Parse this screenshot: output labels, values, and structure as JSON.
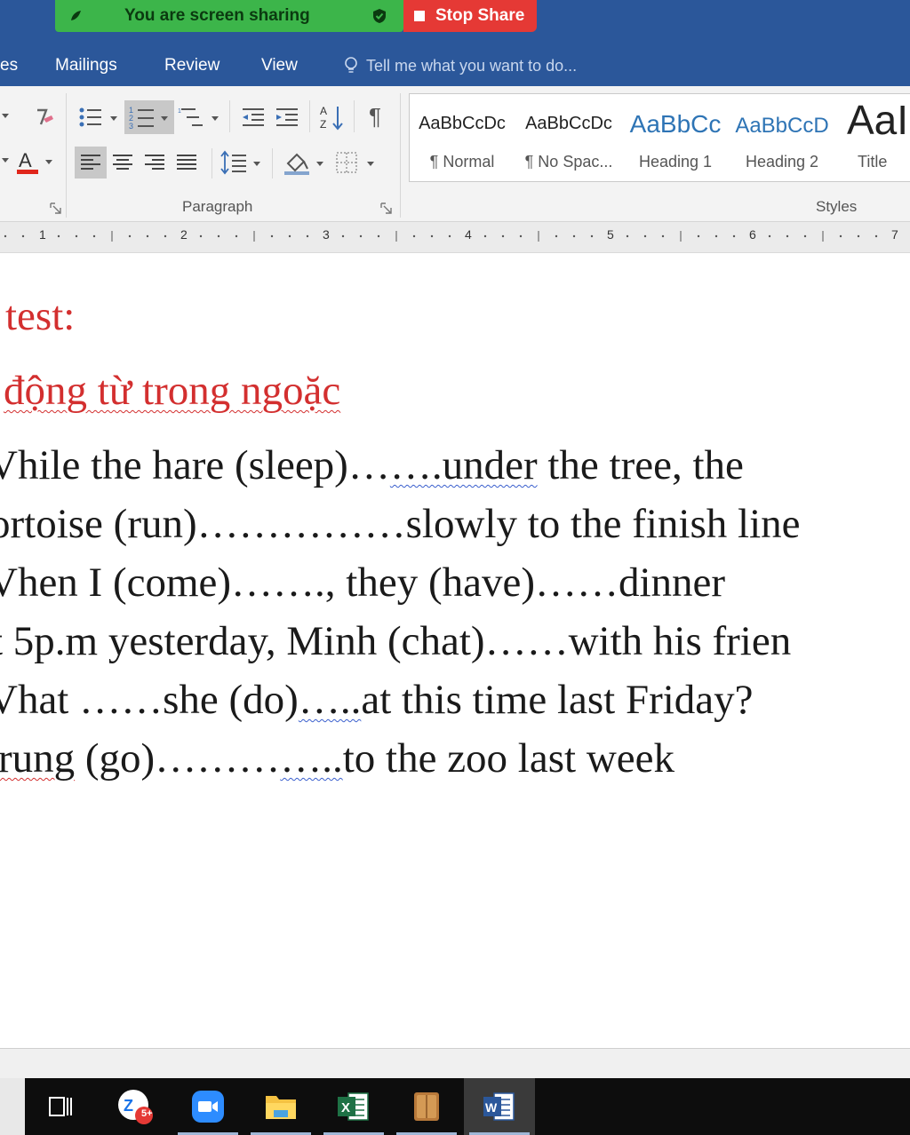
{
  "share": {
    "banner_text": "You are screen sharing",
    "stop_label": "Stop Share"
  },
  "ribbon": {
    "tabs": [
      "es",
      "Mailings",
      "Review",
      "View"
    ],
    "tell_me_placeholder": "Tell me what you want to do...",
    "paragraph_label": "Paragraph",
    "styles_label": "Styles",
    "styles": [
      {
        "preview": "AaBbCcDc",
        "label": "¶ Normal"
      },
      {
        "preview": "AaBbCcDc",
        "label": "¶ No Spac..."
      },
      {
        "preview": "AaBbCc",
        "label": "Heading 1"
      },
      {
        "preview": "AaBbCcD",
        "label": "Heading 2"
      },
      {
        "preview": "AaI",
        "label": "Title"
      }
    ]
  },
  "ruler": {
    "numbers": [
      "1",
      "2",
      "3",
      "4",
      "5",
      "6",
      "7"
    ]
  },
  "document": {
    "heading": "test:",
    "instruction": "động từ trong ngoặc",
    "lines": [
      {
        "pre": "Vhile the hare (sleep)…",
        "squig": "….under",
        "post": " the tree, the"
      },
      {
        "pre": "ortoise (run)……………slowly to the finish line",
        "squig": "",
        "post": ""
      },
      {
        "pre": "Vhen I (come)……., they (have)……dinner",
        "squig": "",
        "post": ""
      },
      {
        "pre": "t 5p.m yesterday, Minh (chat)……with his frien",
        "squig": "",
        "post": ""
      },
      {
        "pre": "Vhat ……she (do)",
        "squig": "…..",
        "post": "at this time last Friday?"
      },
      {
        "pre": "",
        "squig_red": "rung",
        "mid": " (go)………",
        "squig": "…..",
        "post": "to the zoo last week"
      }
    ]
  },
  "taskbar": {
    "zalo_badge": "5+",
    "apps": [
      "task-view",
      "zalo",
      "zoom",
      "file-explorer",
      "excel",
      "book-app",
      "word"
    ]
  },
  "colors": {
    "word_blue": "#2b579a",
    "share_green": "#3cb54a",
    "stop_red": "#e53935",
    "doc_red": "#d32f2f"
  }
}
